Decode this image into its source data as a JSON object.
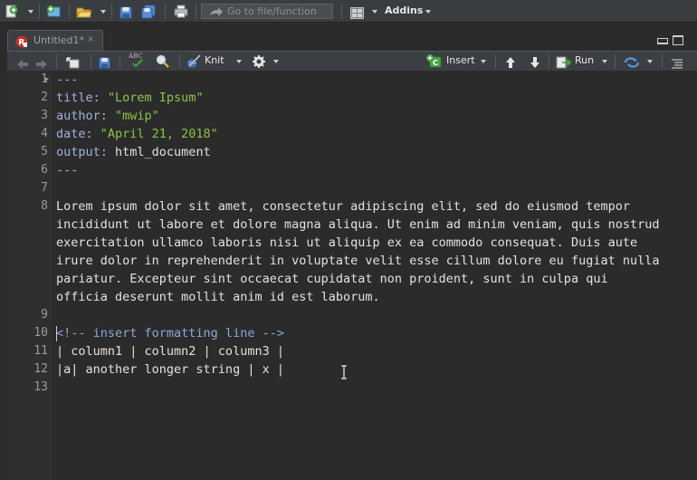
{
  "toolbar": {
    "goto_placeholder": "Go to file/function",
    "addins_label": "Addins"
  },
  "tab": {
    "title": "Untitled1*",
    "close": "×"
  },
  "editor_toolbar": {
    "knit_label": "Knit",
    "insert_label": "Insert",
    "run_label": "Run",
    "spell_label": "ABC"
  },
  "editor": {
    "line_numbers": [
      "1",
      "2",
      "3",
      "4",
      "5",
      "6",
      "7",
      "8",
      "",
      "",
      "",
      "",
      "",
      "9",
      "10",
      "11",
      "12",
      "13"
    ],
    "lines": {
      "l1": "---",
      "l2_key": "title:",
      "l2_val": " \"Lorem Ipsum\"",
      "l3_key": "author:",
      "l3_val": " \"mwip\"",
      "l4_key": "date:",
      "l4_val": " \"April 21, 2018\"",
      "l5_key": "output:",
      "l5_val": " html_document",
      "l6": "---",
      "l8a": "Lorem ipsum dolor sit amet, consectetur adipiscing elit, sed do eiusmod tempor",
      "l8b": "incididunt ut labore et dolore magna aliqua. Ut enim ad minim veniam, quis nostrud",
      "l8c": "exercitation ullamco laboris nisi ut aliquip ex ea commodo consequat. Duis aute",
      "l8d": "irure dolor in reprehenderit in voluptate velit esse cillum dolore eu fugiat nulla",
      "l8e": "pariatur. Excepteur sint occaecat cupidatat non proident, sunt in culpa qui",
      "l8f": "officia deserunt mollit anim id est laborum.",
      "l10": "<!-- insert formatting line -->",
      "l11": "| column1 | column2 | column3 |",
      "l12": "|a| another longer string | x |"
    }
  },
  "colors": {
    "yaml_key": "#a3b2dd",
    "string": "#8bc34a",
    "comment": "#8fa8d6",
    "text": "#e6e1dc",
    "background": "#2b2b2b"
  }
}
